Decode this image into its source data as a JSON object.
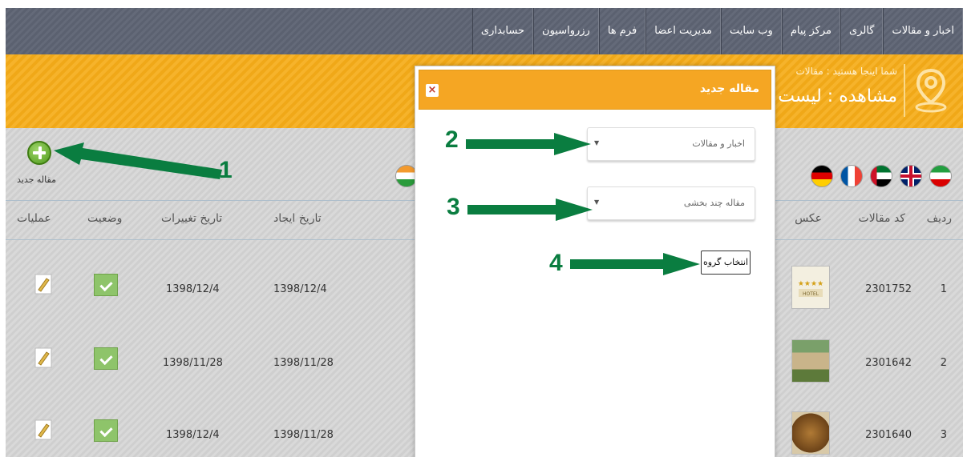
{
  "nav": {
    "items": [
      "اخبار و مقالات",
      "گالری",
      "مرکز پیام",
      "وب سایت",
      "مدیریت اعضا",
      "فرم ها",
      "رزرواسیون",
      "حسابداری"
    ]
  },
  "banner": {
    "breadcrumb": "شما اینجا هستید : مقالات",
    "title": "مشاهده : لیست"
  },
  "toolbar": {
    "add_label": "مقاله جدید"
  },
  "flags": [
    "iran-flag-icon",
    "uk-flag-icon",
    "uae-flag-icon",
    "france-flag-icon",
    "germany-flag-icon",
    "india-flag-icon"
  ],
  "table": {
    "headers": {
      "row": "ردیف",
      "code": "کد مقالات",
      "image": "عکس",
      "created": "تاریخ ایجاد",
      "modified": "تاریخ تغییرات",
      "status": "وضعیت",
      "ops": "عملیات"
    },
    "rows": [
      {
        "row": "1",
        "code": "2301752",
        "created": "1398/12/4",
        "modified": "1398/12/4"
      },
      {
        "row": "2",
        "code": "2301642",
        "created": "1398/11/28",
        "modified": "1398/11/28"
      },
      {
        "row": "3",
        "code": "2301640",
        "created": "1398/11/28",
        "modified": "1398/12/4"
      }
    ]
  },
  "modal": {
    "title": "مقاله جدید",
    "close": "×",
    "category_select": "اخبار و مقالات",
    "type_select": "مقاله چند بخشی",
    "group_button": "انتخاب گروه"
  },
  "annotations": {
    "n1": "1",
    "n2": "2",
    "n3": "3",
    "n4": "4"
  },
  "colors": {
    "nav_bg": "#5b6170",
    "banner": "#f5a623",
    "annotation": "#0a7d40",
    "check": "#8ec46a"
  }
}
